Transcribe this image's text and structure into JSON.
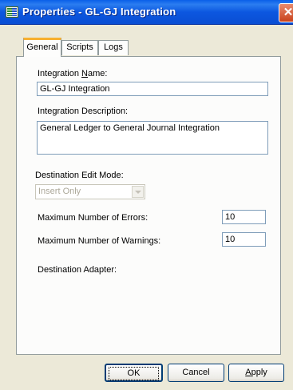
{
  "window": {
    "title": "Properties - GL-GJ Integration",
    "close_glyph": "✕"
  },
  "tabs": [
    {
      "label": "General",
      "active": true
    },
    {
      "label": "Scripts",
      "active": false
    },
    {
      "label": "Logs",
      "active": false
    }
  ],
  "general": {
    "name_label_pre": "Integration ",
    "name_label_key": "N",
    "name_label_post": "ame:",
    "name_value": "GL-GJ Integration",
    "description_label": "Integration Description:",
    "description_value": "General Ledger to General Journal Integration",
    "edit_mode_label": "Destination Edit Mode:",
    "edit_mode_value": "Insert Only",
    "max_errors_label": "Maximum Number of Errors:",
    "max_errors_value": "10",
    "max_warnings_label": "Maximum Number of Warnings:",
    "max_warnings_value": "10",
    "adapter_label": "Destination Adapter:"
  },
  "buttons": {
    "ok": "OK",
    "cancel": "Cancel",
    "apply_key": "A",
    "apply_rest": "pply"
  }
}
